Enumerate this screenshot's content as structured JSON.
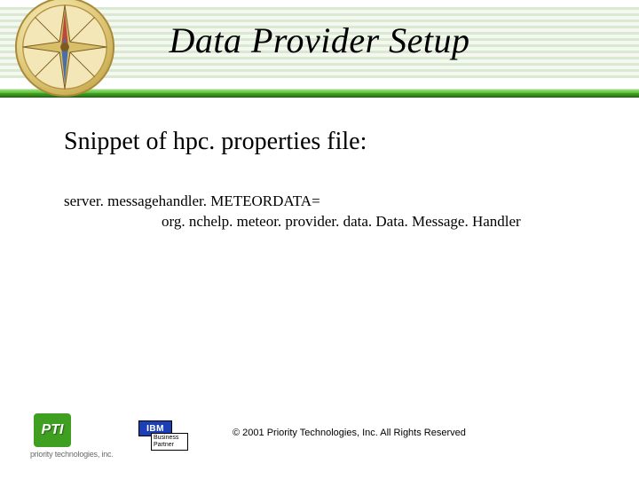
{
  "title": "Data Provider Setup",
  "subheading": "Snippet of hpc. properties file:",
  "snippet": {
    "line1": "server. messagehandler. METEORDATA=",
    "line2": "org. nchelp. meteor. provider. data. Data. Message. Handler"
  },
  "logos": {
    "pti_abbrev": "PTI",
    "pti_full": "priority technologies, inc.",
    "ibm_label": "IBM",
    "ibm_sub1": "Business",
    "ibm_sub2": "Partner"
  },
  "copyright": "© 2001 Priority Technologies, Inc. All Rights Reserved"
}
